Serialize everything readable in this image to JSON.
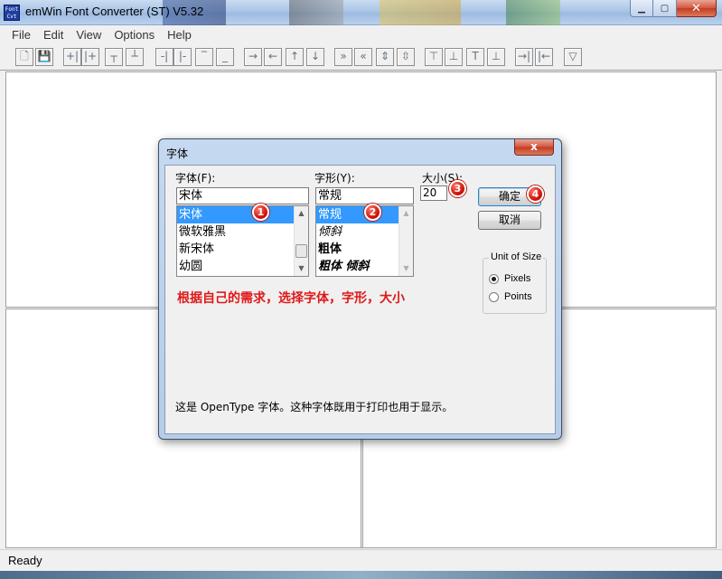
{
  "window": {
    "title": "emWin Font Converter (ST) V5.32",
    "icon_text": "Font Cvt",
    "minimize_icon": "minimize-icon",
    "maximize_icon": "maximize-icon",
    "close_icon": "close-icon"
  },
  "menu": [
    "File",
    "Edit",
    "View",
    "Options",
    "Help"
  ],
  "toolbar": [
    {
      "name": "new-file-button",
      "glyph": "🗋"
    },
    {
      "name": "save-button",
      "glyph": "💾"
    },
    {
      "name": "insert-left-button",
      "glyph": "+|"
    },
    {
      "name": "insert-right-button",
      "glyph": "|+"
    },
    {
      "name": "insert-top-button",
      "glyph": "┬"
    },
    {
      "name": "insert-bottom-button",
      "glyph": "┴"
    },
    {
      "name": "delete-left-button",
      "glyph": "-|"
    },
    {
      "name": "delete-right-button",
      "glyph": "|-"
    },
    {
      "name": "delete-top-button",
      "glyph": "‾"
    },
    {
      "name": "delete-bottom-button",
      "glyph": "_"
    },
    {
      "name": "shift-right-button",
      "glyph": "→"
    },
    {
      "name": "shift-left-button",
      "glyph": "←"
    },
    {
      "name": "shift-up-button",
      "glyph": "↑"
    },
    {
      "name": "shift-down-button",
      "glyph": "↓"
    },
    {
      "name": "move-right-button",
      "glyph": "»"
    },
    {
      "name": "move-left-button",
      "glyph": "«"
    },
    {
      "name": "expand-vertical-button",
      "glyph": "⇕"
    },
    {
      "name": "shrink-vertical-button",
      "glyph": "⇳"
    },
    {
      "name": "align-top-button",
      "glyph": "⊤"
    },
    {
      "name": "align-bottom-button",
      "glyph": "⊥"
    },
    {
      "name": "align-mid-top-button",
      "glyph": "T"
    },
    {
      "name": "align-mid-bottom-button",
      "glyph": "⊥"
    },
    {
      "name": "goto-end-button",
      "glyph": "→|"
    },
    {
      "name": "goto-start-button",
      "glyph": "|←"
    },
    {
      "name": "filter-button",
      "glyph": "▽"
    }
  ],
  "status": "Ready",
  "dialog": {
    "title": "字体",
    "close_glyph": "x",
    "font_label": "字体(F):",
    "font_value": "宋体",
    "font_list": [
      "宋体",
      "微软雅黑",
      "新宋体",
      "幼圆"
    ],
    "style_label": "字形(Y):",
    "style_value": "常规",
    "style_list": [
      "常规",
      "倾斜",
      "粗体",
      "粗体 倾斜"
    ],
    "size_label": "大小(S):",
    "size_value": "20",
    "ok_label": "确定",
    "cancel_label": "取消",
    "unit_group_label": "Unit of Size",
    "unit_pixels": "Pixels",
    "unit_points": "Points",
    "unit_selected": "Pixels",
    "annotation": "根据自己的需求，选择字体，字形，大小",
    "description": "这是 OpenType 字体。这种字体既用于打印也用于显示。",
    "badges": [
      "1",
      "2",
      "3",
      "4"
    ]
  },
  "colors": {
    "selection": "#3399ff",
    "annotation": "#e01818",
    "badge": "#d3150e"
  }
}
